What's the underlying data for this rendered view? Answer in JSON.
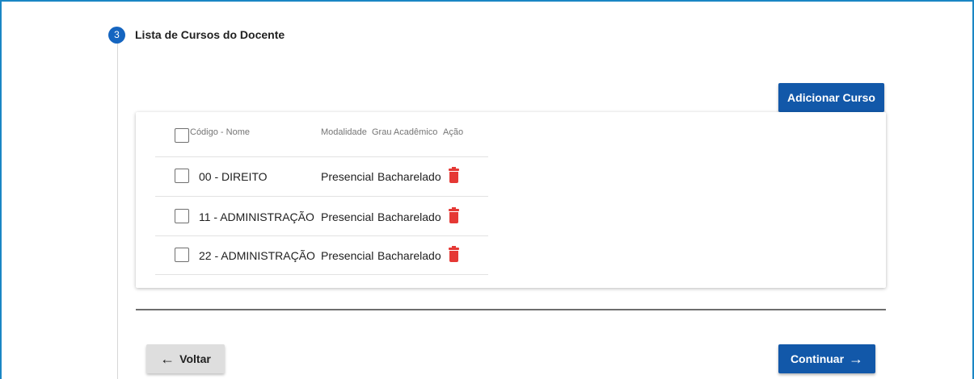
{
  "step": {
    "number": "3",
    "title": "Lista de Cursos do Docente"
  },
  "actions": {
    "add_course": "Adicionar Curso",
    "back": "Voltar",
    "continue": "Continuar"
  },
  "table": {
    "headers": {
      "code_name": "Código - Nome",
      "modality": "Modalidade",
      "degree": "Grau Acadêmico",
      "action": "Ação"
    },
    "rows": [
      {
        "code_name": "00  - DIREITO",
        "modality": "Presencial",
        "degree": "Bacharelado",
        "action_icon": "trash-icon"
      },
      {
        "code_name": "11 - ADMINISTRAÇÃO",
        "modality": "Presencial",
        "degree": "Bacharelado",
        "action_icon": "trash-icon"
      },
      {
        "code_name": "22 - ADMINISTRAÇÃO",
        "modality": "Presencial",
        "degree": "Bacharelado",
        "action_icon": "trash-icon"
      }
    ]
  },
  "colors": {
    "primary": "#1258a9",
    "step_badge": "#1565c0",
    "frame_border": "#1a86c4",
    "delete": "#e53935"
  }
}
